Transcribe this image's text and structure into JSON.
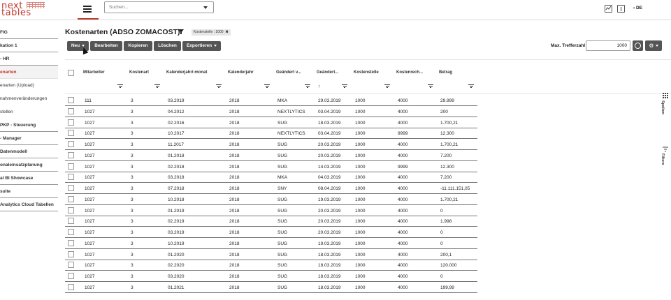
{
  "app": {
    "logo_line1": "next",
    "logo_line2": "tables",
    "search_placeholder": "Suchen...",
    "language": "DE"
  },
  "sidebar": {
    "items": [
      {
        "label": "FIG",
        "style": "bold"
      },
      {
        "label": "kation 1",
        "style": "bold"
      },
      {
        "label": "- HR",
        "style": "bold"
      },
      {
        "label": "enarten",
        "style": "active"
      },
      {
        "label": "enarten (Upload)",
        "style": "plain"
      },
      {
        "label": "nahmenveränderungen",
        "style": "plain"
      },
      {
        "label": "stellen",
        "style": "plain"
      },
      {
        "label": "PKP - Steuerung",
        "style": "bold"
      },
      {
        "label": "- Manager",
        "style": "bold"
      },
      {
        "label": "Datenmodell",
        "style": "bold"
      },
      {
        "label": "onaleinsatzplanung",
        "style": "bold"
      },
      {
        "label": "al BI Showcase",
        "style": "bold"
      },
      {
        "label": "suite",
        "style": "bold"
      },
      {
        "label": "Analytics Cloud Tabellen",
        "style": "bold"
      }
    ]
  },
  "page": {
    "title": "Kostenarten (ADSO ZOMACOST)",
    "filter_chip": "Kostenstelle : 1000",
    "chip_close": "✖"
  },
  "toolbar": {
    "new_label": "Neu",
    "edit_label": "Bearbeiten",
    "copy_label": "Kopieren",
    "delete_label": "Löschen",
    "export_label": "Exportieren",
    "max_hits_label": "Max. Trefferzahl",
    "max_hits_value": "1000",
    "gear_label": "⚙"
  },
  "table": {
    "columns": [
      "Mitarbeiter",
      "Kostenart",
      "Kalenderjahr/-monat",
      "Kalenderjahr",
      "Geändert v...",
      "Geändert...",
      "Kostenstelle",
      "Kostenrech...",
      "Betrag"
    ],
    "sort_indicator": "↑",
    "rows": [
      [
        "111",
        "3",
        "03.2019",
        "2018",
        "MKA",
        "29.03.2019",
        "1000",
        "4000",
        "29.999"
      ],
      [
        "1027",
        "3",
        "04.2012",
        "2018",
        "NEXTLYTICS",
        "03.04.2019",
        "1000",
        "4000",
        "200"
      ],
      [
        "1027",
        "3",
        "02.2016",
        "2018",
        "SUG",
        "18.03.2019",
        "1000",
        "4000",
        "1.700,21"
      ],
      [
        "1027",
        "3",
        "10.2017",
        "2018",
        "NEXTLYTICS",
        "03.04.2019",
        "1000",
        "9999",
        "12.300"
      ],
      [
        "1027",
        "3",
        "11.2017",
        "2018",
        "SUG",
        "20.03.2019",
        "1000",
        "4000",
        "1.700,21"
      ],
      [
        "1027",
        "3",
        "01.2018",
        "2018",
        "SUG",
        "20.03.2019",
        "1000",
        "4000",
        "7.200"
      ],
      [
        "1027",
        "3",
        "02.2018",
        "2018",
        "SUG",
        "14.03.2019",
        "1000",
        "9999",
        "12.300"
      ],
      [
        "1027",
        "3",
        "03.2018",
        "2018",
        "MKA",
        "04.03.2019",
        "1000",
        "4000",
        "7.200"
      ],
      [
        "1027",
        "3",
        "07.2018",
        "2018",
        "SNY",
        "08.04.2019",
        "1000",
        "4000",
        "-11.111.151,05"
      ],
      [
        "1027",
        "3",
        "10.2018",
        "2018",
        "SUG",
        "19.03.2019",
        "1000",
        "4000",
        "1.700,21"
      ],
      [
        "1027",
        "3",
        "01.2019",
        "2018",
        "SUG",
        "20.03.2019",
        "1000",
        "4000",
        "0"
      ],
      [
        "1027",
        "3",
        "02.2019",
        "2018",
        "SUG",
        "20.03.2019",
        "1000",
        "4000",
        "1.998"
      ],
      [
        "1027",
        "3",
        "03.2019",
        "2018",
        "SUG",
        "20.03.2019",
        "1000",
        "4000",
        "0"
      ],
      [
        "1027",
        "3",
        "10.2019",
        "2018",
        "SUG",
        "19.03.2019",
        "1000",
        "4000",
        "0"
      ],
      [
        "1027",
        "3",
        "01.2020",
        "2018",
        "SUG",
        "18.03.2019",
        "1000",
        "4000",
        "200,1"
      ],
      [
        "1027",
        "3",
        "02.2020",
        "2018",
        "SUG",
        "18.03.2019",
        "1000",
        "4000",
        "120.000"
      ],
      [
        "1027",
        "3",
        "03.2020",
        "2018",
        "SUG",
        "18.03.2019",
        "1000",
        "4000",
        "0"
      ],
      [
        "1027",
        "3",
        "01.2021",
        "2018",
        "SUG",
        "18.03.2019",
        "1000",
        "4000",
        "199,99"
      ]
    ]
  },
  "side_panels": {
    "columns_tab": "Spalten",
    "filters_tab": "Filters"
  }
}
